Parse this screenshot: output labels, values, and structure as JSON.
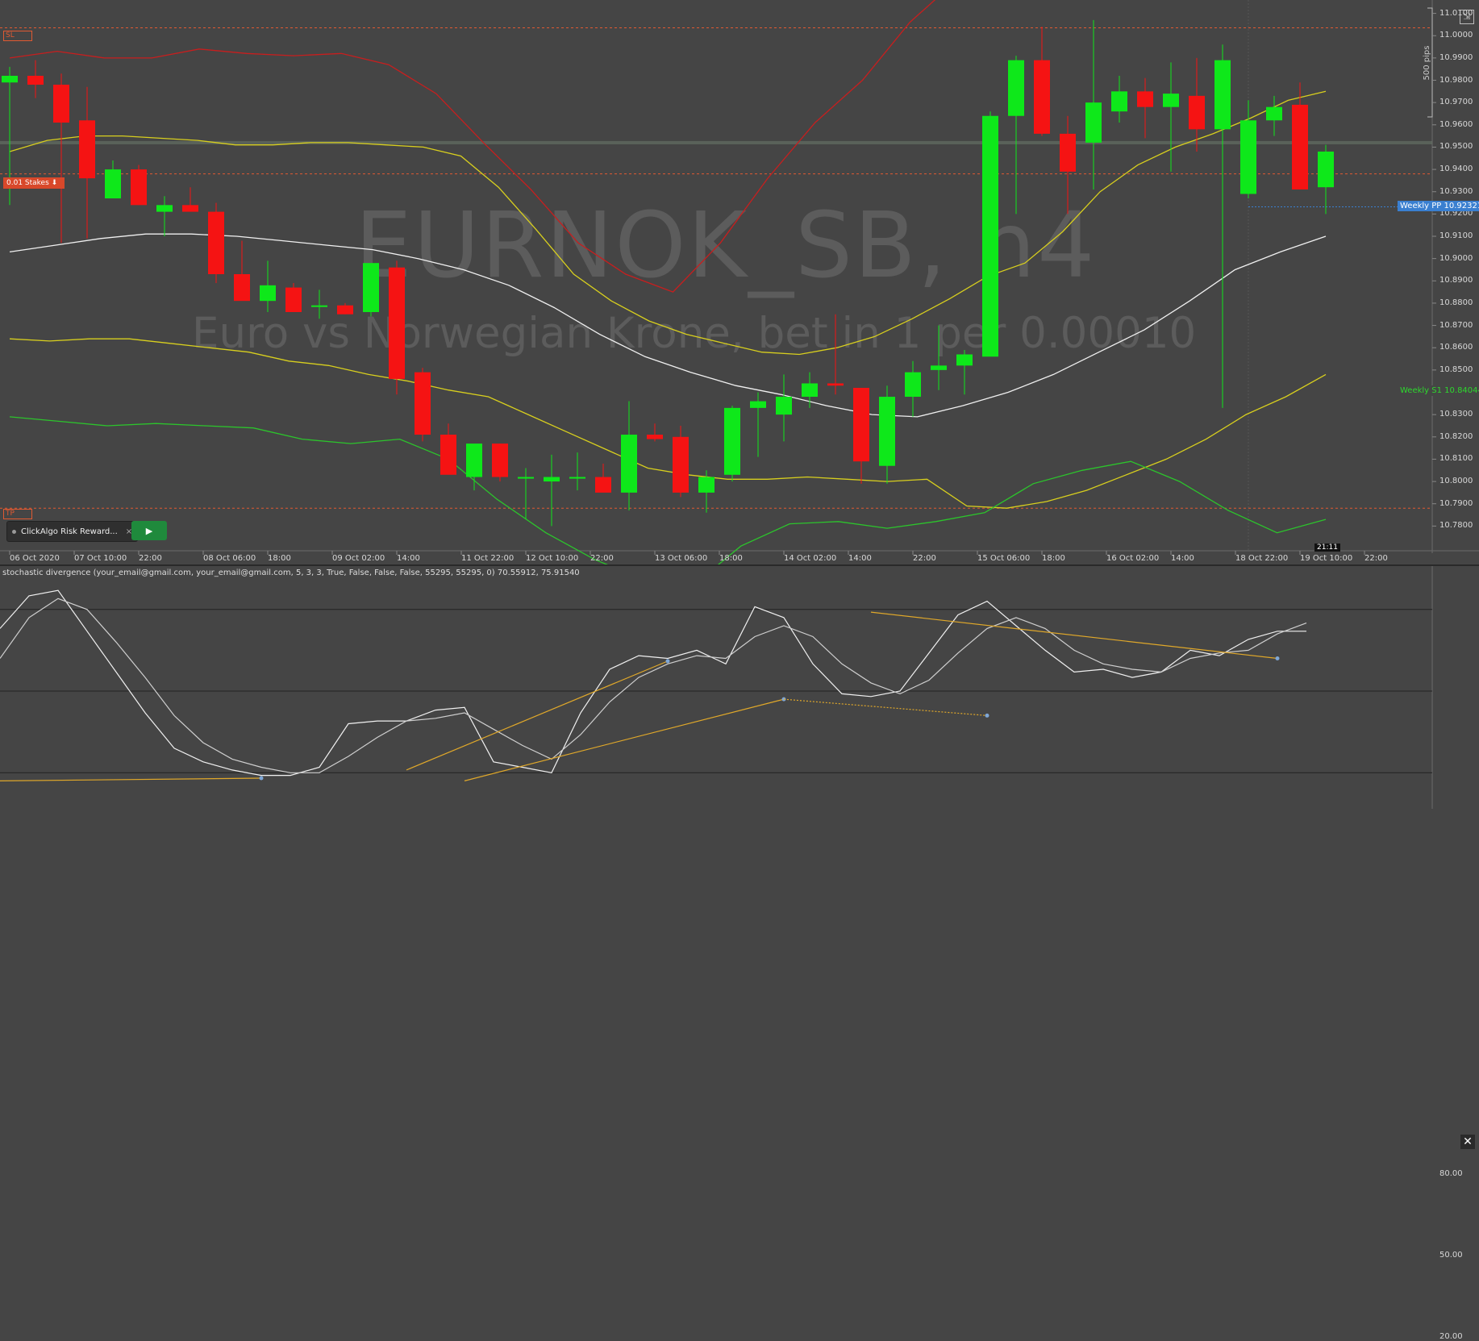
{
  "symbol": "EURNOK_SB, h4",
  "description": "Euro vs Norwegian Krone, bet in 1 per 0.00010",
  "indicator_title": "stochastic divergence (your_email@gmail.com, your_email@gmail.com, 5, 3, 3, True, False, False, False, 55295, 55295, 0) 70.55912, 75.91540",
  "tags": {
    "sl": "SL",
    "tp": "TP",
    "stake": "0.01 Stakes ⬇"
  },
  "bot": {
    "label": "ClickAlgo Risk Reward...",
    "close": "×",
    "play": "▶"
  },
  "pips_label": "500 pips",
  "time_badge": "21:11",
  "close_pane": "✕",
  "maximize_icon": "⇲",
  "colors": {
    "bull": "#0ee81a",
    "bear": "#f51313",
    "bg": "#454545",
    "yellow": "#d8cf1e",
    "white": "#f0f0f0",
    "green_line": "#2cc42c",
    "red_line": "#c81e1e",
    "orange_dash": "#e05a32",
    "pp": "#3a7fd0"
  },
  "price_axis": {
    "labels": [
      "11.0100",
      "11.0000",
      "10.9900",
      "10.9800",
      "10.9700",
      "10.9600",
      "10.9500",
      "10.9400",
      "10.9300",
      "10.9200",
      "10.9100",
      "10.9000",
      "10.8900",
      "10.8800",
      "10.8700",
      "10.8600",
      "10.8500",
      "10.8400",
      "10.8300",
      "10.8200",
      "10.8100",
      "10.8000",
      "10.7900",
      "10.7800"
    ]
  },
  "pivots": [
    {
      "name": "Weekly PP",
      "value": "10.92321"
    },
    {
      "name": "Weekly S1",
      "value": "10.84044"
    }
  ],
  "time_axis": {
    "labels": [
      "06 Oct 2020",
      "07 Oct 10:00",
      "22:00",
      "08 Oct 06:00",
      "18:00",
      "09 Oct 02:00",
      "14:00",
      "11 Oct 22:00",
      "12 Oct 10:00",
      "22:00",
      "13 Oct 06:00",
      "18:00",
      "14 Oct 02:00",
      "14:00",
      "22:00",
      "15 Oct 06:00",
      "18:00",
      "16 Oct 02:00",
      "14:00",
      "18 Oct 22:00",
      "19 Oct 10:00",
      "22:00"
    ]
  },
  "osc_axis": {
    "labels": [
      "80.00",
      "50.00",
      "20.00"
    ]
  },
  "chart_data": {
    "type": "candlestick",
    "candles": [
      {
        "o": 10.979,
        "h": 10.986,
        "l": 10.924,
        "c": 10.982
      },
      {
        "o": 10.982,
        "h": 10.989,
        "l": 10.972,
        "c": 10.978
      },
      {
        "o": 10.978,
        "h": 10.983,
        "l": 10.907,
        "c": 10.961
      },
      {
        "o": 10.962,
        "h": 10.977,
        "l": 10.909,
        "c": 10.936
      },
      {
        "o": 10.927,
        "h": 10.944,
        "l": 10.929,
        "c": 10.94
      },
      {
        "o": 10.94,
        "h": 10.942,
        "l": 10.924,
        "c": 10.924
      },
      {
        "o": 10.921,
        "h": 10.928,
        "l": 10.91,
        "c": 10.924
      },
      {
        "o": 10.924,
        "h": 10.932,
        "l": 10.922,
        "c": 10.921
      },
      {
        "o": 10.921,
        "h": 10.925,
        "l": 10.889,
        "c": 10.893
      },
      {
        "o": 10.893,
        "h": 10.908,
        "l": 10.882,
        "c": 10.881
      },
      {
        "o": 10.881,
        "h": 10.899,
        "l": 10.876,
        "c": 10.888
      },
      {
        "o": 10.887,
        "h": 10.889,
        "l": 10.878,
        "c": 10.876
      },
      {
        "o": 10.8785,
        "h": 10.886,
        "l": 10.873,
        "c": 10.879
      },
      {
        "o": 10.879,
        "h": 10.88,
        "l": 10.875,
        "c": 10.875
      },
      {
        "o": 10.876,
        "h": 10.894,
        "l": 10.874,
        "c": 10.898
      },
      {
        "o": 10.896,
        "h": 10.899,
        "l": 10.839,
        "c": 10.846
      },
      {
        "o": 10.849,
        "h": 10.851,
        "l": 10.818,
        "c": 10.821
      },
      {
        "o": 10.821,
        "h": 10.826,
        "l": 10.804,
        "c": 10.803
      },
      {
        "o": 10.802,
        "h": 10.815,
        "l": 10.796,
        "c": 10.817
      },
      {
        "o": 10.817,
        "h": 10.817,
        "l": 10.8,
        "c": 10.802
      },
      {
        "o": 10.802,
        "h": 10.806,
        "l": 10.783,
        "c": 10.802
      },
      {
        "o": 10.8,
        "h": 10.812,
        "l": 10.78,
        "c": 10.802
      },
      {
        "o": 10.802,
        "h": 10.813,
        "l": 10.796,
        "c": 10.802
      },
      {
        "o": 10.802,
        "h": 10.808,
        "l": 10.796,
        "c": 10.795
      },
      {
        "o": 10.795,
        "h": 10.836,
        "l": 10.787,
        "c": 10.821
      },
      {
        "o": 10.821,
        "h": 10.826,
        "l": 10.818,
        "c": 10.819
      },
      {
        "o": 10.82,
        "h": 10.825,
        "l": 10.793,
        "c": 10.795
      },
      {
        "o": 10.795,
        "h": 10.805,
        "l": 10.786,
        "c": 10.802
      },
      {
        "o": 10.803,
        "h": 10.834,
        "l": 10.8,
        "c": 10.833
      },
      {
        "o": 10.833,
        "h": 10.84,
        "l": 10.811,
        "c": 10.836
      },
      {
        "o": 10.83,
        "h": 10.848,
        "l": 10.818,
        "c": 10.838
      },
      {
        "o": 10.838,
        "h": 10.849,
        "l": 10.833,
        "c": 10.844
      },
      {
        "o": 10.844,
        "h": 10.875,
        "l": 10.839,
        "c": 10.843
      },
      {
        "o": 10.842,
        "h": 10.842,
        "l": 10.799,
        "c": 10.809
      },
      {
        "o": 10.807,
        "h": 10.843,
        "l": 10.799,
        "c": 10.838
      },
      {
        "o": 10.838,
        "h": 10.854,
        "l": 10.829,
        "c": 10.849
      },
      {
        "o": 10.85,
        "h": 10.87,
        "l": 10.841,
        "c": 10.852
      },
      {
        "o": 10.852,
        "h": 10.859,
        "l": 10.839,
        "c": 10.857
      },
      {
        "o": 10.856,
        "h": 10.966,
        "l": 10.857,
        "c": 10.964
      },
      {
        "o": 10.964,
        "h": 10.991,
        "l": 10.92,
        "c": 10.989
      },
      {
        "o": 10.989,
        "h": 11.004,
        "l": 10.955,
        "c": 10.956
      },
      {
        "o": 10.956,
        "h": 10.964,
        "l": 10.92,
        "c": 10.939
      },
      {
        "o": 10.952,
        "h": 11.007,
        "l": 10.931,
        "c": 10.97
      },
      {
        "o": 10.966,
        "h": 10.982,
        "l": 10.961,
        "c": 10.975
      },
      {
        "o": 10.975,
        "h": 10.981,
        "l": 10.954,
        "c": 10.968
      },
      {
        "o": 10.968,
        "h": 10.988,
        "l": 10.939,
        "c": 10.974
      },
      {
        "o": 10.973,
        "h": 10.99,
        "l": 10.948,
        "c": 10.958
      },
      {
        "o": 10.958,
        "h": 10.996,
        "l": 10.833,
        "c": 10.989
      },
      {
        "o": 10.929,
        "h": 10.971,
        "l": 10.927,
        "c": 10.962
      },
      {
        "o": 10.962,
        "h": 10.973,
        "l": 10.955,
        "c": 10.968
      },
      {
        "o": 10.969,
        "h": 10.979,
        "l": 10.931,
        "c": 10.931
      },
      {
        "o": 10.932,
        "h": 10.951,
        "l": 10.92,
        "c": 10.948
      }
    ],
    "yellow_upper": [
      10.948,
      10.953,
      10.955,
      10.955,
      10.954,
      10.953,
      10.951,
      10.951,
      10.952,
      10.952,
      10.951,
      10.95,
      10.946,
      10.932,
      10.913,
      10.893,
      10.881,
      10.872,
      10.866,
      10.862,
      10.858,
      10.857,
      10.86,
      10.865,
      10.873,
      10.882,
      10.892,
      10.898,
      10.912,
      10.93,
      10.942,
      10.95,
      10.956,
      10.963,
      10.971,
      10.975
    ],
    "yellow_lower": [
      10.864,
      10.863,
      10.864,
      10.864,
      10.862,
      10.86,
      10.858,
      10.854,
      10.852,
      10.848,
      10.845,
      10.841,
      10.838,
      10.83,
      10.822,
      10.814,
      10.806,
      10.803,
      10.801,
      10.801,
      10.802,
      10.801,
      10.8,
      10.801,
      10.789,
      10.788,
      10.791,
      10.796,
      10.803,
      10.81,
      10.819,
      10.83,
      10.838,
      10.848
    ],
    "white_line": [
      10.903,
      10.906,
      10.909,
      10.911,
      10.911,
      10.91,
      10.908,
      10.906,
      10.904,
      10.9,
      10.895,
      10.888,
      10.878,
      10.866,
      10.856,
      10.849,
      10.843,
      10.839,
      10.834,
      10.83,
      10.829,
      10.834,
      10.84,
      10.848,
      10.858,
      10.868,
      10.881,
      10.895,
      10.903,
      10.91
    ],
    "red_line": [
      10.99,
      10.993,
      10.99,
      10.99,
      10.994,
      10.992,
      10.991,
      10.992,
      10.987,
      10.974,
      10.952,
      10.931,
      10.907,
      10.893,
      10.885,
      10.907,
      10.936,
      10.961,
      10.98,
      11.006,
      11.025
    ],
    "green_line": [
      10.829,
      10.827,
      10.825,
      10.826,
      10.825,
      10.824,
      10.819,
      10.817,
      10.819,
      10.81,
      10.792,
      10.777,
      10.765,
      10.756,
      10.753,
      10.771,
      10.781,
      10.782,
      10.779,
      10.782,
      10.786,
      10.799,
      10.805,
      10.809,
      10.8,
      10.787,
      10.777,
      10.783
    ],
    "levels": {
      "sl": 11.0035,
      "tp": 10.788,
      "stake": 10.938,
      "weekly_pp": 10.92321,
      "weekly_s1": 10.84044,
      "horizontal_grey": 10.952
    },
    "stochastic_k": [
      73,
      85,
      87,
      72,
      57,
      42,
      29,
      24,
      21,
      19,
      19,
      22,
      38,
      39,
      39,
      43,
      44,
      24,
      22,
      20,
      42,
      58,
      63,
      62,
      65,
      60,
      81,
      77,
      60,
      49,
      48,
      50,
      64,
      78,
      83,
      74,
      65,
      57,
      58,
      55,
      57,
      65,
      63,
      69,
      72,
      72
    ],
    "stochastic_d": [
      62,
      77,
      84,
      80,
      68,
      55,
      41,
      31,
      25,
      22,
      20,
      20,
      26,
      33,
      39,
      40,
      42,
      36,
      30,
      25,
      34,
      46,
      55,
      60,
      63,
      62,
      70,
      74,
      70,
      60,
      53,
      49,
      54,
      64,
      73,
      77,
      73,
      65,
      60,
      58,
      57,
      62,
      64,
      65,
      71,
      75
    ],
    "osc_range": [
      10,
      90
    ],
    "divergence_lines": [
      {
        "from": [
          0,
          17
        ],
        "to": [
          9,
          18
        ],
        "style": "solid"
      },
      {
        "from": [
          14,
          21
        ],
        "to": [
          23,
          61
        ],
        "style": "solid"
      },
      {
        "from": [
          16,
          17
        ],
        "to": [
          27,
          47
        ],
        "style": "solid"
      },
      {
        "from": [
          27,
          47
        ],
        "to": [
          34,
          41
        ],
        "style": "dotted"
      },
      {
        "from": [
          30,
          79
        ],
        "to": [
          44,
          62
        ],
        "style": "solid"
      }
    ]
  }
}
